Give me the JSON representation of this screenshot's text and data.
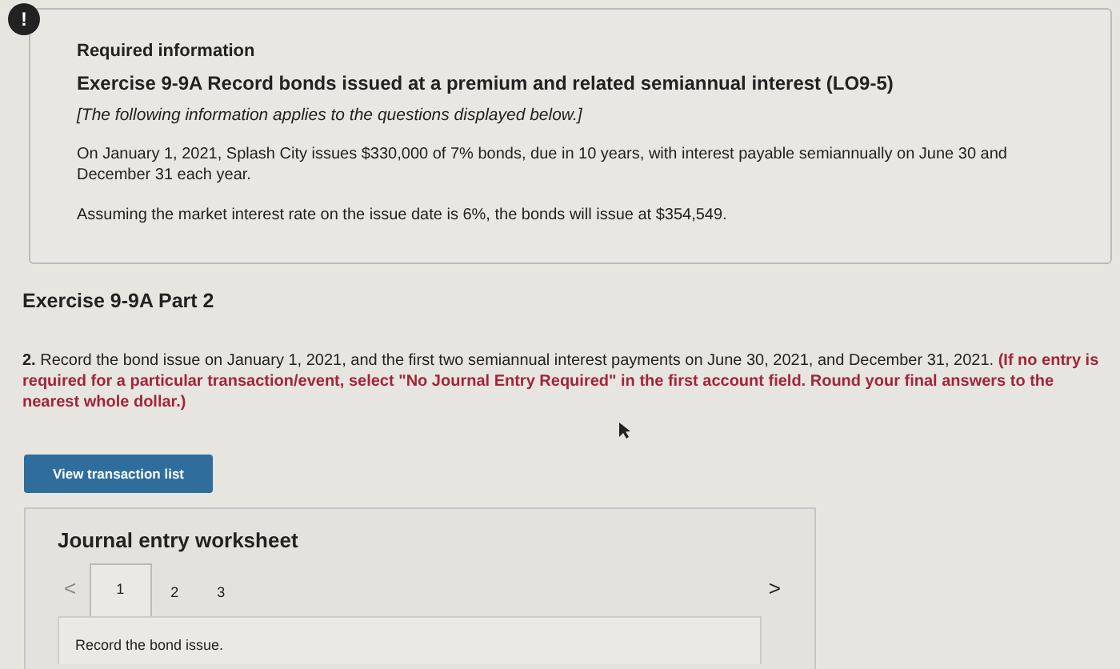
{
  "alert_icon": "!",
  "info": {
    "heading": "Required information",
    "title": "Exercise 9-9A Record bonds issued at a premium and related semiannual interest (LO9-5)",
    "note": "[The following information applies to the questions displayed below.]",
    "paragraphs": [
      "On January 1, 2021, Splash City issues $330,000 of 7% bonds, due in 10 years, with interest payable semiannually on June 30 and December 31 each year.",
      "Assuming the market interest rate on the issue date is 6%, the bonds will issue at $354,549."
    ]
  },
  "part_title": "Exercise 9-9A Part 2",
  "question": {
    "number": "2.",
    "text": "Record the bond issue on January 1, 2021, and the first two semiannual interest payments on June 30, 2021, and December 31, 2021.",
    "instruction": "(If no entry is required for a particular transaction/event, select \"No Journal Entry Required\" in the first account field. Round your final answers to the nearest whole dollar.)"
  },
  "view_button": "View transaction list",
  "worksheet": {
    "title": "Journal entry worksheet",
    "prev": "<",
    "next": ">",
    "tabs": [
      {
        "label": "1",
        "selected": true
      },
      {
        "label": "2",
        "selected": false
      },
      {
        "label": "3",
        "selected": false
      }
    ],
    "instruction": "Record the bond issue."
  }
}
